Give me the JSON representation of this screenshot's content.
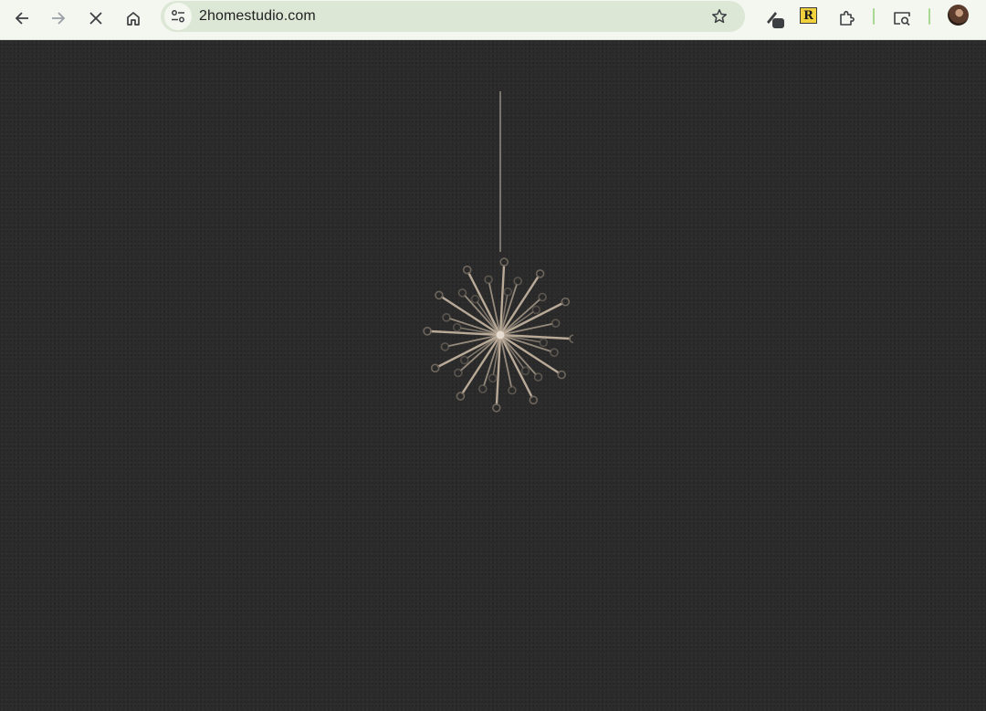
{
  "browser": {
    "url": "2homestudio.com",
    "nav": {
      "back_icon": "arrow-left-icon",
      "forward_icon": "arrow-right-icon",
      "stop_icon": "close-icon",
      "home_icon": "home-icon"
    },
    "extensions": {
      "r_label": "R"
    }
  },
  "page": {
    "background_color": "#2b2b2b",
    "ornament_color": "#b9aa98",
    "loading": true
  }
}
